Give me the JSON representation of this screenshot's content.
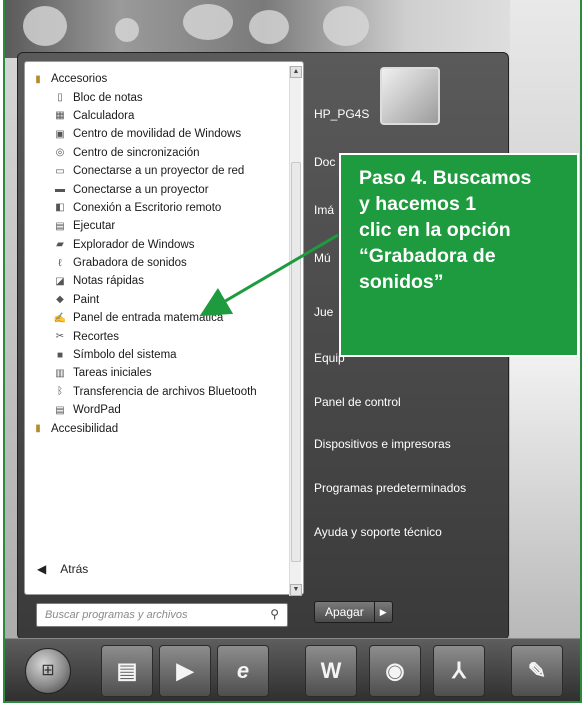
{
  "start_menu": {
    "programs": [
      {
        "label": "Accesorios",
        "icon": "folder-icon",
        "folder": true
      },
      {
        "label": "Bloc de notas",
        "icon": "notepad-icon"
      },
      {
        "label": "Calculadora",
        "icon": "calculator-icon"
      },
      {
        "label": "Centro de movilidad de Windows",
        "icon": "mobility-center-icon"
      },
      {
        "label": "Centro de sincronización",
        "icon": "sync-center-icon"
      },
      {
        "label": "Conectarse a un proyector de red",
        "icon": "network-projector-icon"
      },
      {
        "label": "Conectarse a un proyector",
        "icon": "projector-icon"
      },
      {
        "label": "Conexión a Escritorio remoto",
        "icon": "remote-desktop-icon"
      },
      {
        "label": "Ejecutar",
        "icon": "run-icon"
      },
      {
        "label": "Explorador de Windows",
        "icon": "explorer-folder-icon"
      },
      {
        "label": "Grabadora de sonidos",
        "icon": "microphone-icon"
      },
      {
        "label": "Notas rápidas",
        "icon": "sticky-notes-icon"
      },
      {
        "label": "Paint",
        "icon": "paint-icon"
      },
      {
        "label": "Panel de entrada matemática",
        "icon": "math-input-icon"
      },
      {
        "label": "Recortes",
        "icon": "snipping-tool-icon"
      },
      {
        "label": "Símbolo del sistema",
        "icon": "command-prompt-icon"
      },
      {
        "label": "Tareas iniciales",
        "icon": "getting-started-icon"
      },
      {
        "label": "Transferencia de archivos Bluetooth",
        "icon": "bluetooth-icon"
      },
      {
        "label": "WordPad",
        "icon": "wordpad-icon"
      },
      {
        "label": "Accesibilidad",
        "icon": "folder-icon",
        "folder": true
      }
    ],
    "back_label": "Atrás",
    "search_placeholder": "Buscar programas y archivos",
    "right_links": [
      "HP_PG4S",
      "Doc",
      "Imá",
      "Mú",
      "Jue",
      "Equip",
      "Panel de control",
      "Dispositivos e impresoras",
      "Programas predeterminados",
      "Ayuda y soporte técnico"
    ],
    "shutdown_label": "Apagar"
  },
  "taskbar": {
    "buttons": [
      "file-manager-icon",
      "media-player-icon",
      "internet-explorer-icon",
      "word-icon",
      "firefox-icon",
      "pdf-reader-icon",
      "paint-brush-icon"
    ]
  },
  "annotation": {
    "text": "Paso 4. Buscamos\ny hacemos 1\nclic en la opción\n“Grabadora de\nsonidos”"
  },
  "colors": {
    "callout": "#1e9b3f",
    "arrow": "#1e9b3f",
    "frame_border": "#2a8a3e"
  }
}
